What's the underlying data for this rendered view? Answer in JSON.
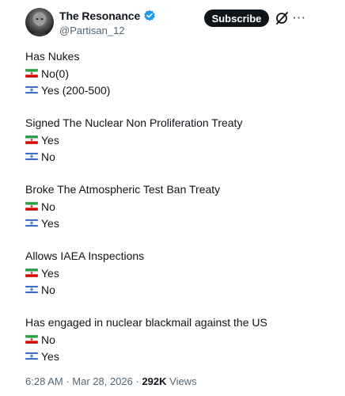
{
  "account": {
    "name": "The Resonance",
    "handle": "@Partisan_12",
    "subscribe_label": "Subscribe",
    "verified_color": "#1d9bf0"
  },
  "sections": [
    {
      "question": "Has Nukes",
      "answers": [
        {
          "flag": "iran-flag-icon",
          "text": "No(0)"
        },
        {
          "flag": "israel-flag-icon",
          "text": "Yes (200-500)"
        }
      ]
    },
    {
      "question": "Signed The Nuclear Non Proliferation Treaty",
      "answers": [
        {
          "flag": "iran-flag-icon",
          "text": "Yes"
        },
        {
          "flag": "israel-flag-icon",
          "text": "No"
        }
      ]
    },
    {
      "question": "Broke The Atmospheric Test Ban Treaty",
      "answers": [
        {
          "flag": "iran-flag-icon",
          "text": "No"
        },
        {
          "flag": "israel-flag-icon",
          "text": "Yes"
        }
      ]
    },
    {
      "question": "Allows IAEA Inspections",
      "answers": [
        {
          "flag": "iran-flag-icon",
          "text": "Yes"
        },
        {
          "flag": "israel-flag-icon",
          "text": "No"
        }
      ]
    },
    {
      "question": "Has engaged in nuclear blackmail against the US",
      "answers": [
        {
          "flag": "iran-flag-icon",
          "text": "No"
        },
        {
          "flag": "israel-flag-icon",
          "text": "Yes"
        }
      ]
    }
  ],
  "footer": {
    "time": "6:28 AM",
    "sep1": " · ",
    "date": "Mar 28, 2026",
    "sep2": " · ",
    "views_count": "292K",
    "views_label": " Views"
  }
}
